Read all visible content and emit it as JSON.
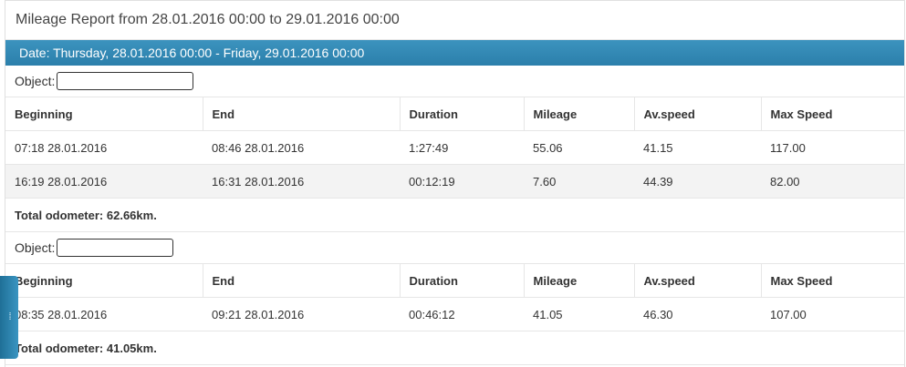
{
  "report": {
    "title": "Mileage Report from 28.01.2016 00:00 to 29.01.2016 00:00",
    "date_bar": "Date: Thursday, 28.01.2016 00:00 - Friday, 29.01.2016 00:00"
  },
  "columns": [
    "Beginning",
    "End",
    "Duration",
    "Mileage",
    "Av.speed",
    "Max Speed"
  ],
  "groups": [
    {
      "object_label": "Object:",
      "object_value": "",
      "rows": [
        [
          "07:18 28.01.2016",
          "08:46 28.01.2016",
          "1:27:49",
          "55.06",
          "41.15",
          "117.00"
        ],
        [
          "16:19 28.01.2016",
          "16:31 28.01.2016",
          "00:12:19",
          "7.60",
          "44.39",
          "82.00"
        ]
      ],
      "total": "Total odometer: 62.66km."
    },
    {
      "object_label": "Object:",
      "object_value": "",
      "rows": [
        [
          "08:35 28.01.2016",
          "09:21 28.01.2016",
          "00:46:12",
          "41.05",
          "46.30",
          "107.00"
        ]
      ],
      "total": "Total odometer: 41.05km."
    }
  ],
  "side_tab": {
    "icon": "grip-handle-icon",
    "glyph": "⁞"
  },
  "colors": {
    "header_bar": "#2b7fab",
    "row_alt": "#f3f3f3"
  }
}
